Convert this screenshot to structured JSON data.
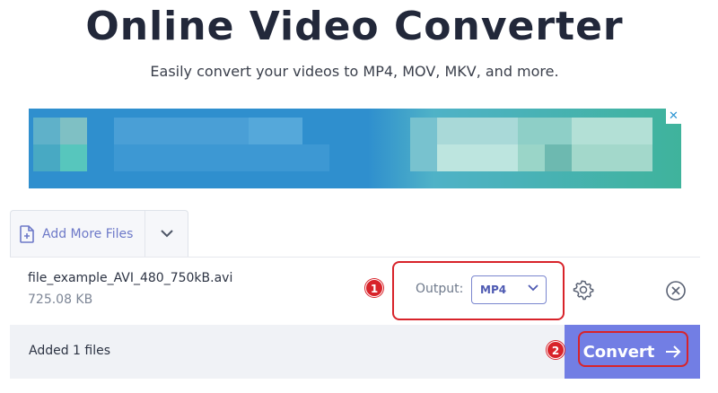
{
  "header": {
    "title": "Online Video Converter",
    "subtitle": "Easily convert your videos to MP4, MOV, MKV, and more."
  },
  "ad": {
    "close_glyph": "✕",
    "accent_color": "#2f8fce"
  },
  "uploader": {
    "add_files_label": "Add More Files",
    "add_files_icon": "file-plus-icon",
    "dropdown_icon": "chevron-down-icon"
  },
  "file": {
    "name": "file_example_AVI_480_750kB.avi",
    "size": "725.08 KB",
    "output_label": "Output:",
    "output_format": "MP4",
    "settings_icon": "gear-icon",
    "remove_icon": "close-circle-icon"
  },
  "footer": {
    "status": "Added 1 files",
    "convert_label": "Convert",
    "convert_icon": "arrow-right-icon",
    "convert_color": "#727ee4"
  },
  "annotations": {
    "step1": "1",
    "step2": "2",
    "highlight_color": "#d8232a"
  }
}
